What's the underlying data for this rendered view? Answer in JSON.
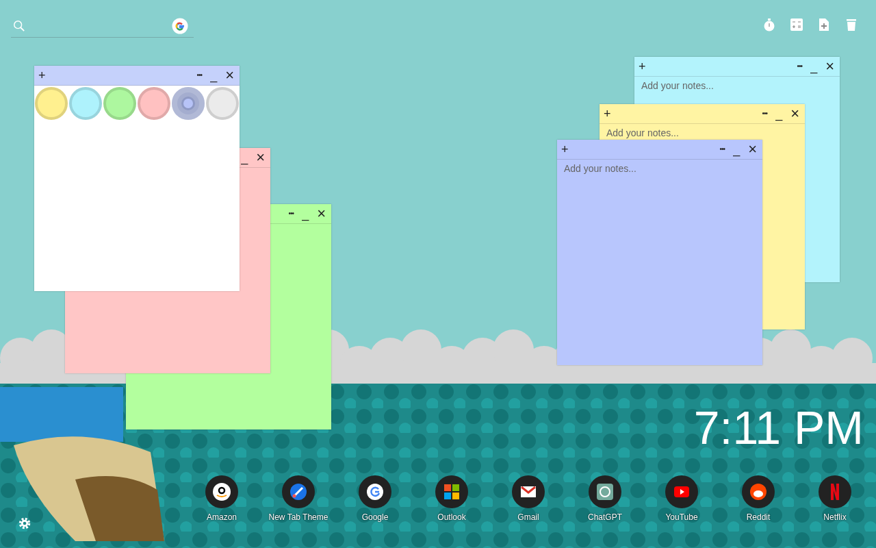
{
  "notes": [
    {
      "kind": "plain",
      "color": "#b3ff9e",
      "buttons": [
        {
          "kind": "more",
          "glyph": "•••"
        },
        {
          "kind": "minimize",
          "glyph": "_"
        },
        {
          "kind": "close",
          "glyph": "×"
        }
      ]
    },
    {
      "kind": "plain",
      "color": "#ffc6c6",
      "buttons": [
        {
          "kind": "minimize",
          "glyph": "_"
        },
        {
          "kind": "close",
          "glyph": "×"
        }
      ]
    },
    {
      "kind": "picker",
      "color": "#c5d1fb",
      "buttons": [
        {
          "kind": "add",
          "glyph": "+"
        },
        {
          "kind": "more",
          "glyph": "•••"
        },
        {
          "kind": "minimize",
          "glyph": "_"
        },
        {
          "kind": "close",
          "glyph": "×"
        }
      ],
      "swatches": [
        {
          "color": "#fff08f",
          "selected": false
        },
        {
          "color": "#aef2fc",
          "selected": false
        },
        {
          "color": "#adf79f",
          "selected": false
        },
        {
          "color": "#ffc1c1",
          "selected": false
        },
        {
          "color": "#8e99c4",
          "selected": true
        },
        {
          "color": "#ebebeb",
          "selected": false
        }
      ]
    },
    {
      "kind": "plain",
      "color": "#b3f3fc",
      "placeholder": "Add your notes...",
      "buttons": [
        {
          "kind": "add",
          "glyph": "+"
        },
        {
          "kind": "more",
          "glyph": "•••"
        },
        {
          "kind": "minimize",
          "glyph": "_"
        },
        {
          "kind": "close",
          "glyph": "×"
        }
      ]
    },
    {
      "kind": "plain",
      "color": "#fff4a3",
      "placeholder": "Add your notes...",
      "buttons": [
        {
          "kind": "add",
          "glyph": "+"
        },
        {
          "kind": "more",
          "glyph": "•••"
        },
        {
          "kind": "minimize",
          "glyph": "_"
        },
        {
          "kind": "close",
          "glyph": "×"
        }
      ]
    },
    {
      "kind": "plain",
      "color": "#b8c6fd",
      "placeholder": "Add your notes...",
      "buttons": [
        {
          "kind": "add",
          "glyph": "+"
        },
        {
          "kind": "more",
          "glyph": "•••"
        },
        {
          "kind": "minimize",
          "glyph": "_"
        },
        {
          "kind": "close",
          "glyph": "×"
        }
      ]
    }
  ],
  "clock": "7:11 PM",
  "shortcuts": [
    {
      "kind": "amazon",
      "label": "Amazon"
    },
    {
      "kind": "brush",
      "label": "New Tab Theme"
    },
    {
      "kind": "google",
      "label": "Google"
    },
    {
      "kind": "windows",
      "label": "Outlook"
    },
    {
      "kind": "mail",
      "label": "Gmail"
    },
    {
      "kind": "knot",
      "label": "ChatGPT"
    },
    {
      "kind": "play",
      "label": "YouTube"
    },
    {
      "kind": "reddit",
      "label": "Reddit"
    },
    {
      "kind": "netflix",
      "label": "Netflix"
    }
  ]
}
